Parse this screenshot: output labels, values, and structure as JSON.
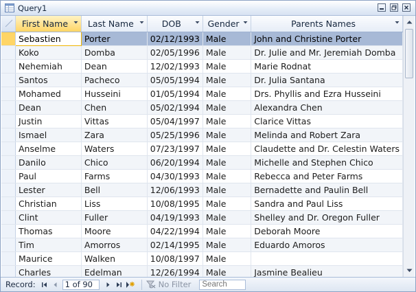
{
  "window": {
    "title": "Query1"
  },
  "columns": [
    {
      "label": "First Name",
      "active": true
    },
    {
      "label": "Last Name",
      "active": false
    },
    {
      "label": "DOB",
      "active": false
    },
    {
      "label": "Gender",
      "active": false
    },
    {
      "label": "Parents Names",
      "active": false
    }
  ],
  "rows": [
    [
      "Sebastien",
      "Porter",
      "02/12/1993",
      "Male",
      "John and Christine Porter"
    ],
    [
      "Koko",
      "Domba",
      "02/05/1996",
      "Male",
      "Dr. Julie and Mr. Jeremiah Domba"
    ],
    [
      "Nehemiah",
      "Dean",
      "12/02/1993",
      "Male",
      "Marie Rodnat"
    ],
    [
      "Santos",
      "Pacheco",
      "05/05/1994",
      "Male",
      "Dr. Julia Santana"
    ],
    [
      "Mohamed",
      "Husseini",
      "01/05/1994",
      "Male",
      "Drs. Phyllis and Ezra Husseini"
    ],
    [
      "Dean",
      "Chen",
      "05/02/1994",
      "Male",
      "Alexandra Chen"
    ],
    [
      "Justin",
      "Vittas",
      "05/04/1997",
      "Male",
      "Clarice Vittas"
    ],
    [
      "Ismael",
      "Zara",
      "05/25/1996",
      "Male",
      "Melinda and Robert Zara"
    ],
    [
      "Anselme",
      "Waters",
      "07/23/1997",
      "Male",
      "Claudette and Dr. Celestin Waters"
    ],
    [
      "Danilo",
      "Chico",
      "06/20/1994",
      "Male",
      "Michelle and Stephen Chico"
    ],
    [
      "Paul",
      "Farms",
      "04/30/1993",
      "Male",
      "Rebecca and Peter Farms"
    ],
    [
      "Lester",
      "Bell",
      "12/06/1993",
      "Male",
      "Bernadette and Paulin Bell"
    ],
    [
      "Christian",
      "Liss",
      "10/08/1995",
      "Male",
      "Sandra and Paul Liss"
    ],
    [
      "Clint",
      "Fuller",
      "04/19/1993",
      "Male",
      "Shelley and Dr. Oregon Fuller"
    ],
    [
      "Thomas",
      "Moore",
      "04/22/1994",
      "Male",
      "Deborah Moore"
    ],
    [
      "Tim",
      "Amorros",
      "02/14/1995",
      "Male",
      "Eduardo Amoros"
    ],
    [
      "Maurice",
      "Walken",
      "10/08/1997",
      "Male",
      ""
    ],
    [
      "Charles",
      "Edelman",
      "12/26/1994",
      "Male",
      "Jasmine Bealieu"
    ]
  ],
  "current_row": 0,
  "navigation": {
    "record_label": "Record:",
    "position": "1 of 90",
    "filter_label": "No Filter",
    "search_placeholder": "Search"
  },
  "colors": {
    "selected_row": "#a7b9d6",
    "active_header": "#ffd566",
    "accent_border": "#8ca2c4"
  },
  "icons": {
    "title": "query-icon",
    "minimize": "minimize-icon",
    "restore": "restore-icon",
    "close": "close-icon",
    "sort": "dropdown-arrow-icon",
    "first": "first-record-icon",
    "prev": "previous-record-icon",
    "next": "next-record-icon",
    "last": "last-record-icon",
    "new": "new-record-icon",
    "filter": "no-filter-icon"
  }
}
